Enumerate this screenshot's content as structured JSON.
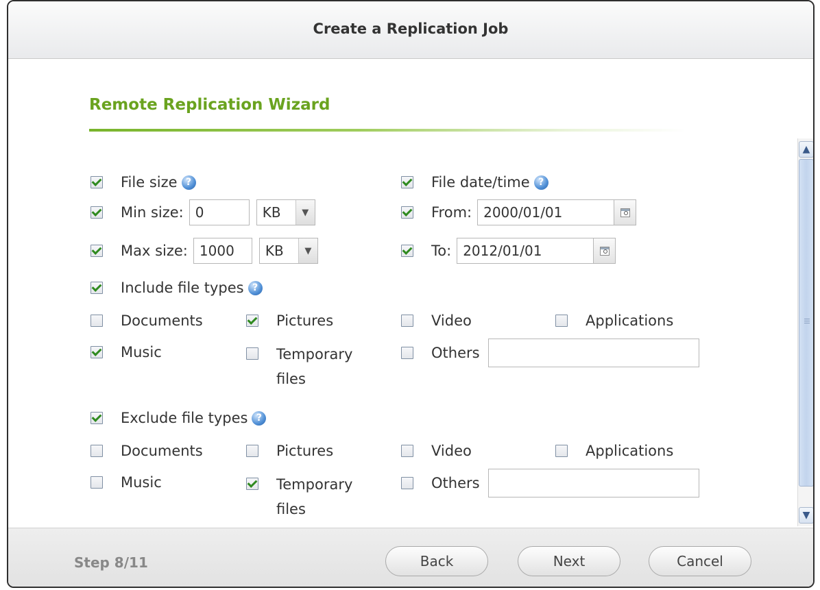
{
  "dialog": {
    "title": "Create a Replication Job"
  },
  "wizard": {
    "title": "Remote Replication Wizard"
  },
  "file_size": {
    "label": "File size",
    "checked": true,
    "min": {
      "label": "Min size:",
      "value": "0",
      "unit": "KB",
      "checked": true
    },
    "max": {
      "label": "Max size:",
      "value": "1000",
      "unit": "KB",
      "checked": true
    }
  },
  "file_date": {
    "label": "File date/time",
    "checked": true,
    "from": {
      "label": "From:",
      "value": "2000/01/01",
      "checked": true
    },
    "to": {
      "label": "To:",
      "value": "2012/01/01",
      "checked": true
    }
  },
  "include": {
    "label": "Include file types",
    "checked": true,
    "documents": {
      "label": "Documents",
      "checked": false
    },
    "pictures": {
      "label": "Pictures",
      "checked": true
    },
    "video": {
      "label": "Video",
      "checked": false
    },
    "applications": {
      "label": "Applications",
      "checked": false
    },
    "music": {
      "label": "Music",
      "checked": true
    },
    "temporary_line1": "Temporary",
    "temporary_line2": "files",
    "temporary_checked": false,
    "others": {
      "label": "Others",
      "checked": false,
      "value": ""
    }
  },
  "exclude": {
    "label": "Exclude file types",
    "checked": true,
    "documents": {
      "label": "Documents",
      "checked": false
    },
    "pictures": {
      "label": "Pictures",
      "checked": false
    },
    "video": {
      "label": "Video",
      "checked": false
    },
    "applications": {
      "label": "Applications",
      "checked": false
    },
    "music": {
      "label": "Music",
      "checked": false
    },
    "temporary_line1": "Temporary",
    "temporary_line2": "files",
    "temporary_checked": true,
    "others": {
      "label": "Others",
      "checked": false,
      "value": ""
    }
  },
  "footer": {
    "step": "Step 8/11",
    "back": "Back",
    "next": "Next",
    "cancel": "Cancel"
  },
  "icons": {
    "help": "help-question-icon",
    "calendar": "calendar-icon",
    "dropdown": "chevron-down-icon"
  },
  "colors": {
    "accent": "#6aa31f",
    "check": "#2f8a1f",
    "help": "#4f8fd6"
  }
}
